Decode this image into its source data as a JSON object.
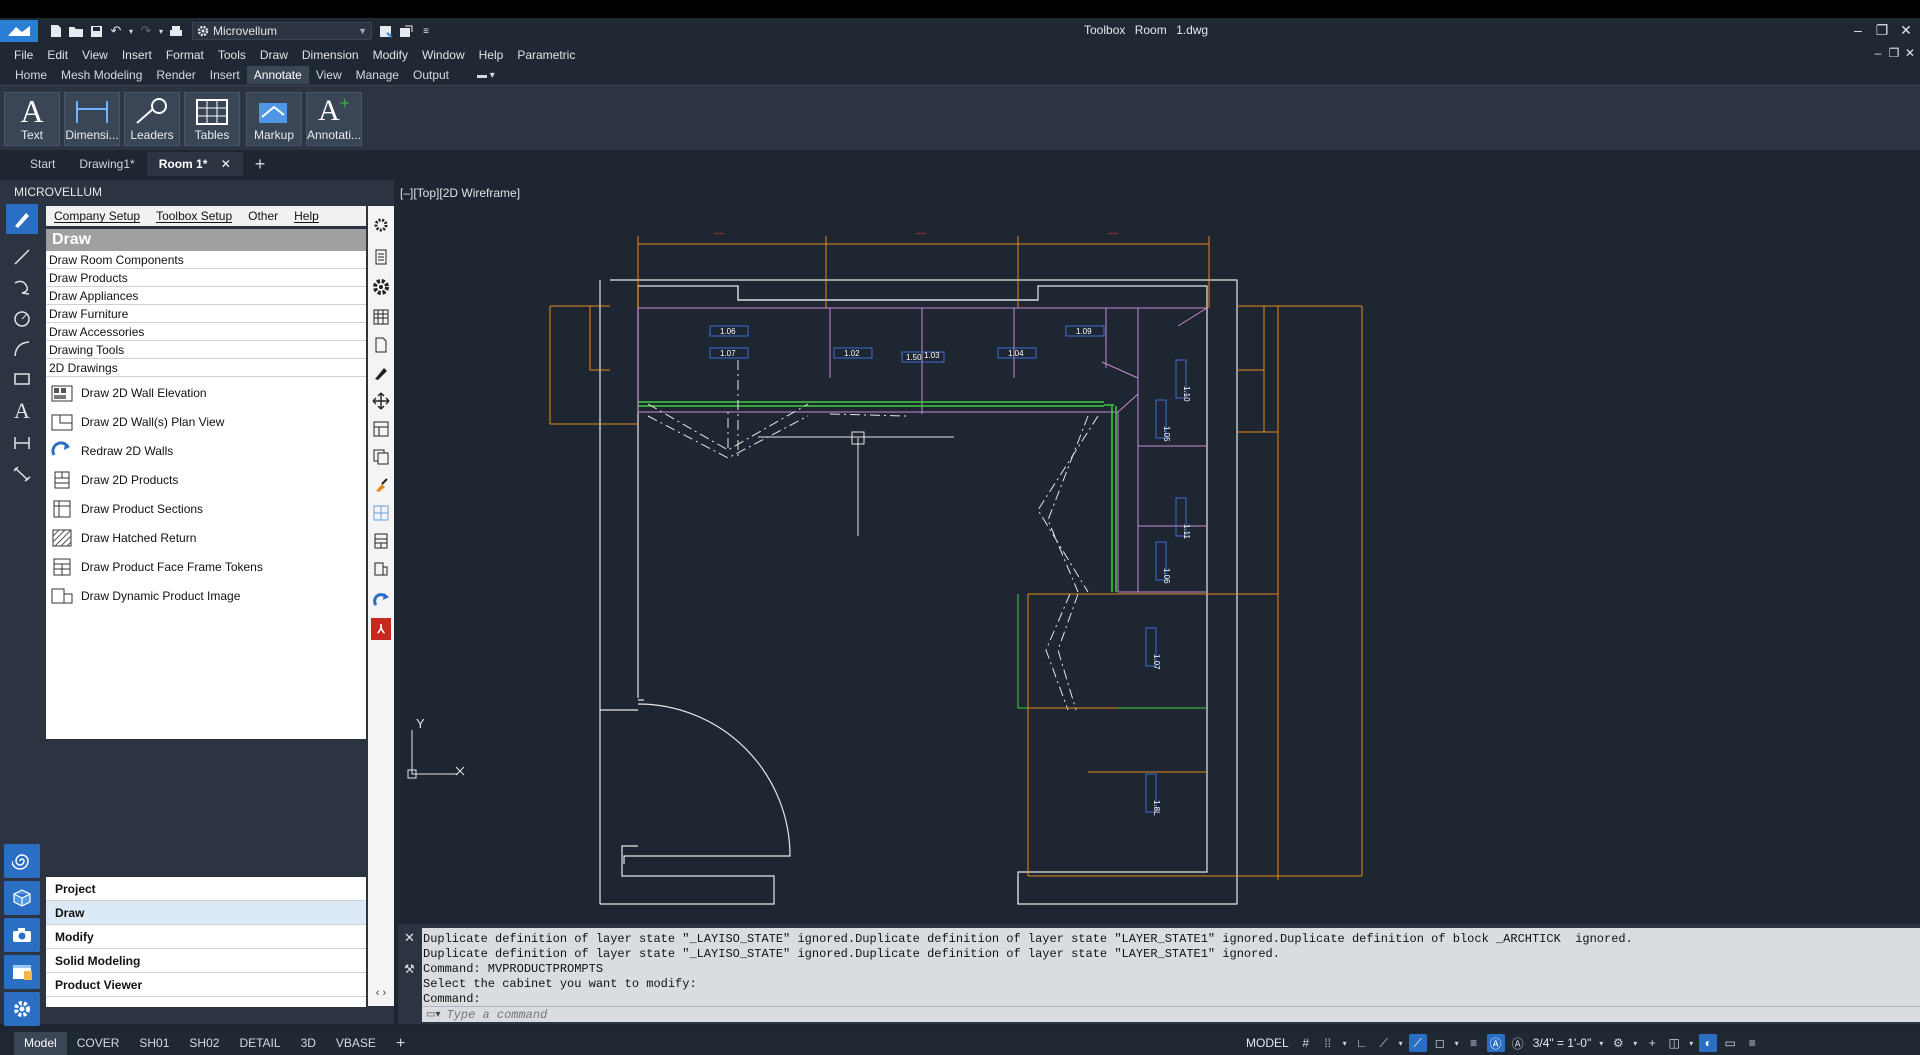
{
  "app": {
    "workspace": "Microvellum",
    "window_title": "Toolbox",
    "document": "Room 1.dwg"
  },
  "menubar": [
    "File",
    "Edit",
    "View",
    "Insert",
    "Format",
    "Tools",
    "Draw",
    "Dimension",
    "Modify",
    "Window",
    "Help",
    "Parametric"
  ],
  "ribbon_tabs": [
    "Home",
    "Mesh Modeling",
    "Render",
    "Insert",
    "Annotate",
    "View",
    "Manage",
    "Output"
  ],
  "ribbon_active_tab": "Annotate",
  "ribbon_buttons": [
    "Text",
    "Dimensi...",
    "Leaders",
    "Tables",
    "Markup",
    "Annotati..."
  ],
  "doc_tabs": [
    "Start",
    "Drawing1*",
    "Room 1*"
  ],
  "doc_active_tab": "Room 1*",
  "panel": {
    "title": "MICROVELLUM",
    "menu": [
      "Company Setup",
      "Toolbox Setup",
      "Other",
      "Help"
    ],
    "draw_header": "Draw",
    "draw_list": [
      "Draw Room Components",
      "Draw Products",
      "Draw Appliances",
      "Draw Furniture",
      "Draw Accessories",
      "Drawing Tools",
      "2D Drawings"
    ],
    "commands": [
      "Draw 2D Wall Elevation",
      "Draw 2D Wall(s) Plan View",
      "Redraw 2D Walls",
      "Draw 2D Products",
      "Draw Product Sections",
      "Draw Hatched Return",
      "Draw Product Face Frame Tokens",
      "Draw Dynamic Product Image"
    ],
    "sections": [
      "Project",
      "Draw",
      "Modify",
      "Solid Modeling",
      "Product Viewer"
    ],
    "active_section": "Draw"
  },
  "canvas": {
    "view_label": "[–][Top][2D Wireframe]",
    "ucs_y": "Y",
    "ucs_x": "X",
    "cabinet_tags": [
      "1.06",
      "1.07",
      "1.02",
      "1.50",
      "1.03",
      "1.04",
      "1.09",
      "1.10",
      "1.05",
      "1.11",
      "1.06",
      "1.07",
      "1.8L"
    ],
    "tag_labels_rotated": [
      "1.10",
      "1.05",
      "1.11",
      "1.06",
      "1.07",
      "1.8L"
    ],
    "colors": {
      "background": "#1e2631",
      "walls": "#e6e6e6",
      "dimension": "#e8891e",
      "cabinet_outline": "#c98ad6",
      "face_frame": "#3fcf3f",
      "tag": "#3f6fd8",
      "hidden": "#e6e6e6"
    }
  },
  "command_line": {
    "history": [
      "Duplicate definition of layer state \"_LAYISO_STATE\" ignored.Duplicate definition of layer state \"LAYER_STATE1\" ignored.Duplicate definition of block _ARCHTICK  ignored.",
      "Duplicate definition of layer state \"_LAYISO_STATE\" ignored.Duplicate definition of layer state \"LAYER_STATE1\" ignored.",
      "Command: MVPRODUCTPROMPTS",
      "Select the cabinet you want to modify:",
      "Command:"
    ],
    "placeholder": "Type a command"
  },
  "layout_tabs": [
    "Model",
    "COVER",
    "SH01",
    "SH02",
    "DETAIL",
    "3D",
    "VBASE"
  ],
  "active_layout": "Model",
  "status": {
    "space": "MODEL",
    "scale": "3/4\" = 1'-0\""
  }
}
